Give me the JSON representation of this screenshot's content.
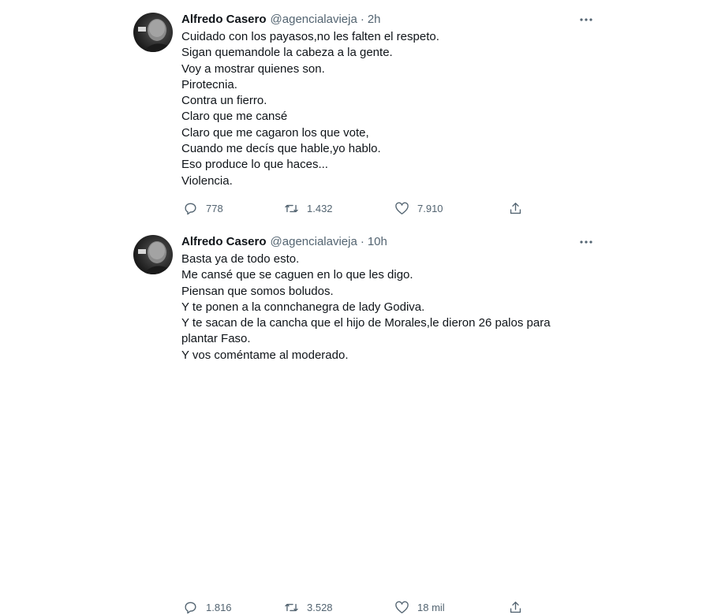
{
  "tweets": [
    {
      "name": "Alfredo Casero",
      "handle": "@agencialavieja",
      "separator": "·",
      "time": "2h",
      "lines": [
        "Cuidado con los payasos,no les falten el respeto.",
        "Sigan quemandole la cabeza a la gente.",
        "Voy a mostrar quienes son.",
        "Pirotecnia.",
        "Contra un fierro.",
        "Claro que me cansé",
        "Claro que me cagaron los que vote,",
        "Cuando me decís que hable,yo hablo.",
        "Eso produce lo que haces...",
        "Violencia."
      ],
      "replies": "778",
      "retweets": "1.432",
      "likes": "7.910"
    },
    {
      "name": "Alfredo Casero",
      "handle": "@agencialavieja",
      "separator": "·",
      "time": "10h",
      "lines": [
        "Basta ya de todo esto.",
        "Me cansé que se caguen en lo que les digo.",
        "Piensan que somos boludos.",
        "Y te ponen a la connchanegra de lady Godiva.",
        "Y te sacan de la cancha que el hijo de Morales,le dieron 26 palos para",
        "plantar Faso.",
        "Y vos coméntame al moderado."
      ],
      "replies": "1.816",
      "retweets": "3.528",
      "likes": "18 mil"
    }
  ],
  "icons": {
    "reply": "reply-icon",
    "retweet": "retweet-icon",
    "like": "heart-icon",
    "share": "share-icon",
    "more": "more-options-icon"
  },
  "colors": {
    "text": "#0f1419",
    "secondary": "#536471",
    "background": "#ffffff"
  }
}
